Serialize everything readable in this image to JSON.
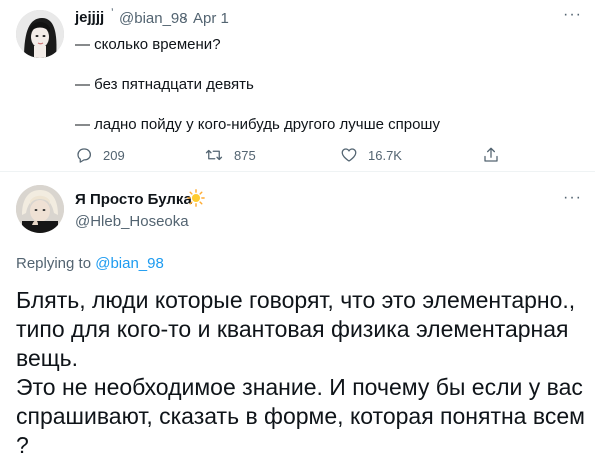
{
  "tweet1": {
    "display_name": "jejjjj",
    "badge": "ʼ",
    "handle": "@bian_98",
    "separator": "·",
    "date": "Apr 1",
    "lines": [
      "— сколько времени?",
      "— без пятнадцати девять",
      "— ладно пойду у кого-нибудь другого лучше спрошу"
    ],
    "reply_count": "209",
    "retweet_count": "875",
    "like_count": "16.7K",
    "more": "···"
  },
  "tweet2": {
    "display_name": "Я Просто Булка",
    "emoji": "sun-emoji",
    "handle": "@Hleb_Hoseoka",
    "more": "···",
    "replying_prefix": "Replying to ",
    "replying_to": "@bian_98",
    "text_lines": [
      "Блять, люди которые говорят, что это элементарно.,",
      "типо для кого-то и квантовая физика элементарная",
      "вещь.",
      "Это не необходимое знание. И почему бы если у вас",
      "спрашивают, сказать в форме, которая понятна всем",
      "?"
    ]
  },
  "colors": {
    "text": "#0f1419",
    "secondary": "#536471",
    "link": "#1d9bf0",
    "divider": "#eff3f4"
  }
}
